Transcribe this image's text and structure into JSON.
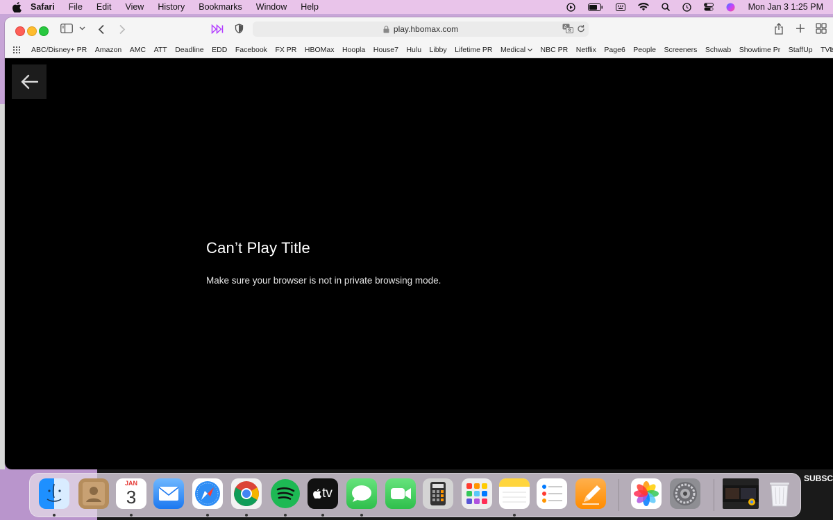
{
  "menubar": {
    "app_name": "Safari",
    "items": [
      "File",
      "Edit",
      "View",
      "History",
      "Bookmarks",
      "Window",
      "Help"
    ],
    "clock": "Mon Jan 3  1:25 PM"
  },
  "browser": {
    "url": "play.hbomax.com",
    "bookmarks": [
      "ABC/Disney+ PR",
      "Amazon",
      "AMC",
      "ATT",
      "Deadline",
      "EDD",
      "Facebook",
      "FX PR",
      "HBOMax",
      "Hoopla",
      "House7",
      "Hulu",
      "Libby",
      "Lifetime PR",
      "Medical",
      "NBC PR",
      "Netflix",
      "Page6",
      "People",
      "Screeners",
      "Schwab",
      "Showtime Pr",
      "StaffUp",
      "TVLine"
    ],
    "bookmarks_more": "»"
  },
  "player": {
    "error_title": "Can’t Play Title",
    "error_message": "Make sure your browser is not in private browsing mode."
  },
  "background": {
    "subscribe_text": "SUBSC"
  },
  "dock": {
    "calendar_month": "JAN",
    "calendar_day": "3",
    "tv_label": "tv",
    "apps": [
      "finder",
      "contacts",
      "calendar",
      "mail",
      "safari",
      "chrome",
      "spotify",
      "apple-tv",
      "messages",
      "facetime",
      "calculator",
      "launchpad",
      "notes",
      "reminders",
      "pages",
      "photos",
      "system-preferences",
      "chrome-window",
      "trash"
    ]
  },
  "colors": {
    "player_bg": "#000000",
    "menubar_bg": "#e9c4ea",
    "accent_hbo": "#b23cff"
  }
}
